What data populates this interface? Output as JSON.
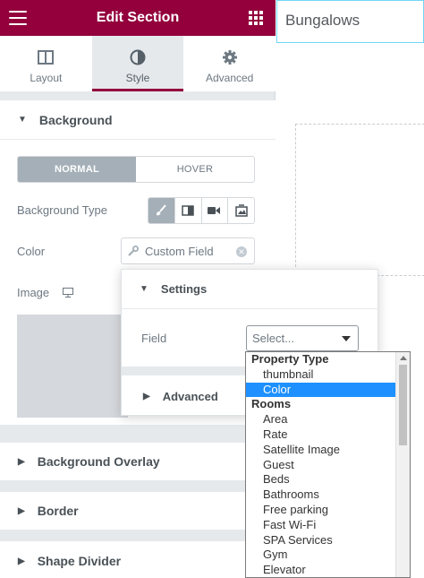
{
  "header": {
    "title": "Edit Section",
    "menu_icon": "hamburger-icon",
    "apps_icon": "grid-icon"
  },
  "tabs": [
    {
      "label": "Layout",
      "icon": "layout-icon",
      "active": false
    },
    {
      "label": "Style",
      "icon": "contrast-icon",
      "active": true
    },
    {
      "label": "Advanced",
      "icon": "gear-icon",
      "active": false
    }
  ],
  "background": {
    "title": "Background",
    "state_tabs": {
      "normal": "NORMAL",
      "hover": "HOVER"
    },
    "type_label": "Background Type",
    "color_label": "Color",
    "color_value": "Custom Field",
    "image_label": "Image"
  },
  "popover": {
    "settings_title": "Settings",
    "field_label": "Field",
    "select_value": "Select...",
    "advanced_title": "Advanced"
  },
  "dropdown": {
    "items": [
      {
        "text": "Property Type",
        "kind": "group"
      },
      {
        "text": "thumbnail",
        "kind": "option"
      },
      {
        "text": "Color",
        "kind": "option",
        "highlighted": true
      },
      {
        "text": "Rooms",
        "kind": "group"
      },
      {
        "text": "Area",
        "kind": "option"
      },
      {
        "text": "Rate",
        "kind": "option"
      },
      {
        "text": "Satellite Image",
        "kind": "option"
      },
      {
        "text": "Guest",
        "kind": "option"
      },
      {
        "text": "Beds",
        "kind": "option"
      },
      {
        "text": "Bathrooms",
        "kind": "option"
      },
      {
        "text": "Free parking",
        "kind": "option"
      },
      {
        "text": "Fast Wi-Fi",
        "kind": "option"
      },
      {
        "text": "SPA Services",
        "kind": "option"
      },
      {
        "text": "Gym",
        "kind": "option"
      },
      {
        "text": "Elevator",
        "kind": "option"
      }
    ]
  },
  "sections": {
    "overlay": "Background Overlay",
    "border": "Border",
    "shape_divider": "Shape Divider"
  },
  "preview": {
    "heading": "Bungalows"
  },
  "colors": {
    "brand": "#93003c",
    "highlight": "#1e90ff",
    "active_segment": "#a4afb7"
  }
}
